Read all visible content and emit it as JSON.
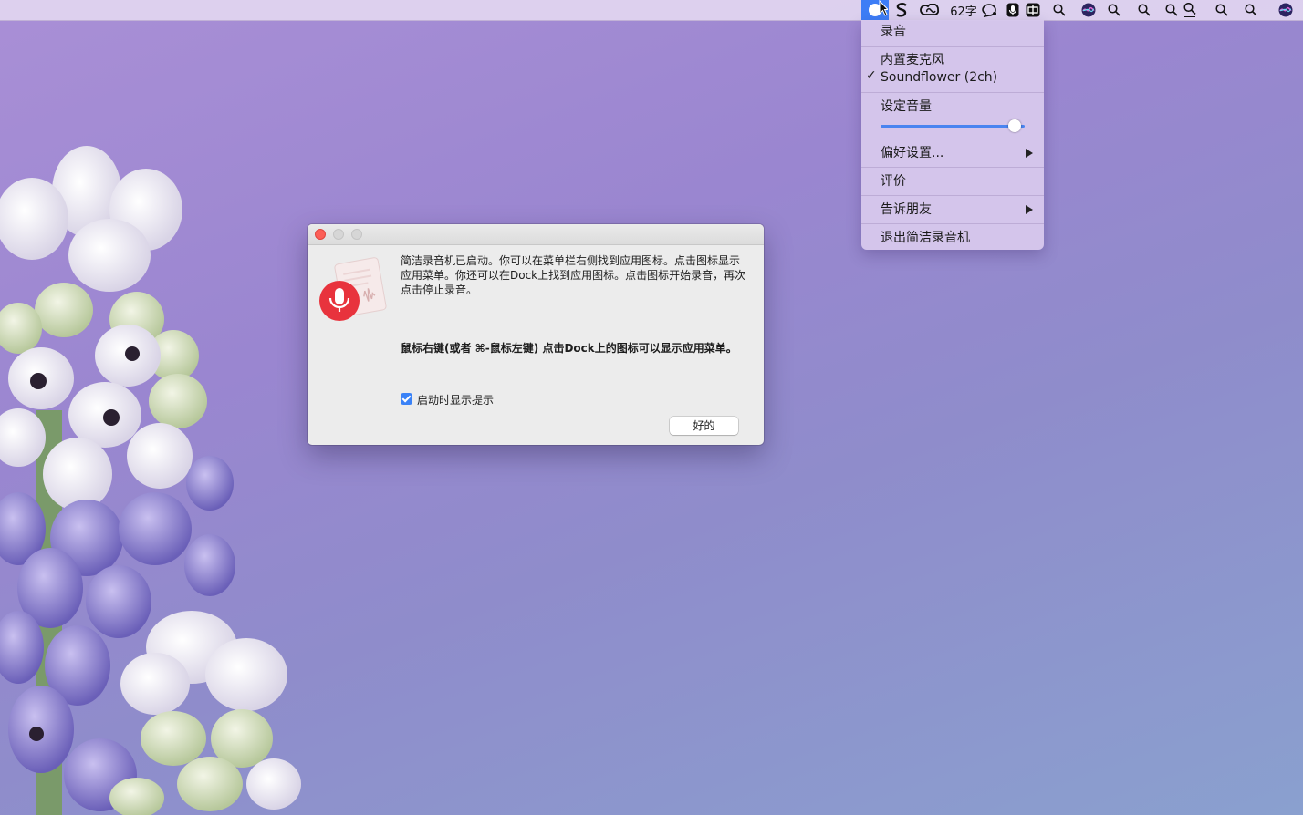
{
  "menubar": {
    "word_count": "62字"
  },
  "menu": {
    "record": "录音",
    "builtin_mic": "内置麦克风",
    "soundflower": "Soundflower (2ch)",
    "check_mark": "✓",
    "set_volume": "设定音量",
    "volume_level": 0.93,
    "preferences": "偏好设置...",
    "rate": "评价",
    "tell_friends": "告诉朋友",
    "quit": "退出简洁录音机"
  },
  "dialog": {
    "message": "简洁录音机已启动。你可以在菜单栏右侧找到应用图标。点击图标显示应用菜单。你还可以在Dock上找到应用图标。点击图标开始录音，再次点击停止录音。",
    "message_bold": "鼠标右键(或者 ⌘-鼠标左键) 点击Dock上的图标可以显示应用菜单。",
    "checkbox_label": "启动时显示提示",
    "checkbox_checked": true,
    "ok_button": "好的"
  },
  "colors": {
    "accent": "#3d7df6",
    "record_red": "#e8333d"
  }
}
